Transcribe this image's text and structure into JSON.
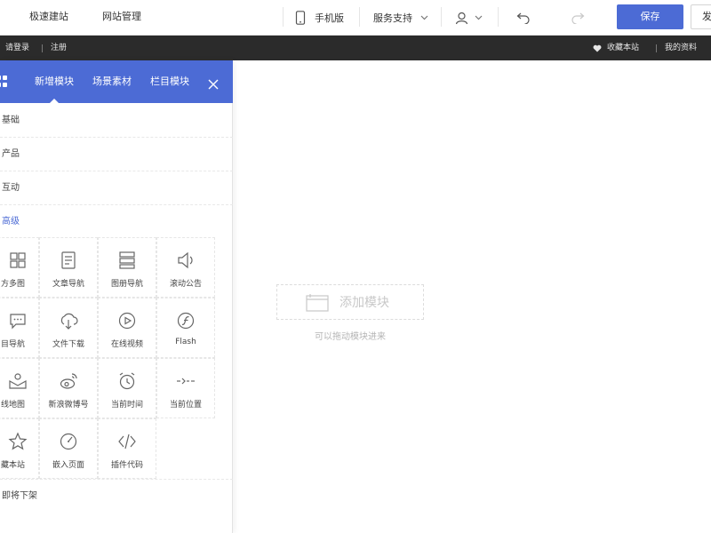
{
  "topbar": {
    "nav_fast_build": "极速建站",
    "nav_site_manage": "网站管理",
    "mobile_version": "手机版",
    "service_support": "服务支持",
    "save_label": "保存",
    "cut_label": "发"
  },
  "blackbar": {
    "login": "请登录",
    "register": "注册",
    "favorite": "收藏本站",
    "my_profile": "我的资料"
  },
  "panel": {
    "tabs": [
      "新增模块",
      "场景素材",
      "栏目模块"
    ],
    "categories": [
      "基础",
      "产品",
      "互动",
      "高级"
    ],
    "footer_category": "即将下架",
    "modules": [
      {
        "label": "方多图",
        "icon": "multi-image-icon"
      },
      {
        "label": "文章导航",
        "icon": "article-nav-icon"
      },
      {
        "label": "图册导航",
        "icon": "album-nav-icon"
      },
      {
        "label": "滚动公告",
        "icon": "scroll-notice-icon"
      },
      {
        "label": "目导航",
        "icon": "chat-nav-icon"
      },
      {
        "label": "文件下载",
        "icon": "file-download-icon"
      },
      {
        "label": "在线视频",
        "icon": "online-video-icon"
      },
      {
        "label": "Flash",
        "icon": "flash-icon"
      },
      {
        "label": "线地图",
        "icon": "map-icon"
      },
      {
        "label": "新浪微博号",
        "icon": "weibo-icon"
      },
      {
        "label": "当前时间",
        "icon": "clock-icon"
      },
      {
        "label": "当前位置",
        "icon": "location-icon"
      },
      {
        "label": "藏本站",
        "icon": "star-icon"
      },
      {
        "label": "嵌入页面",
        "icon": "embed-page-icon"
      },
      {
        "label": "插件代码",
        "icon": "code-icon"
      }
    ]
  },
  "canvas": {
    "add_module": "添加模块",
    "hint": "可以拖动模块进来"
  },
  "colors": {
    "accent": "#4c6bd5",
    "blackbar": "#2b2b2b"
  }
}
